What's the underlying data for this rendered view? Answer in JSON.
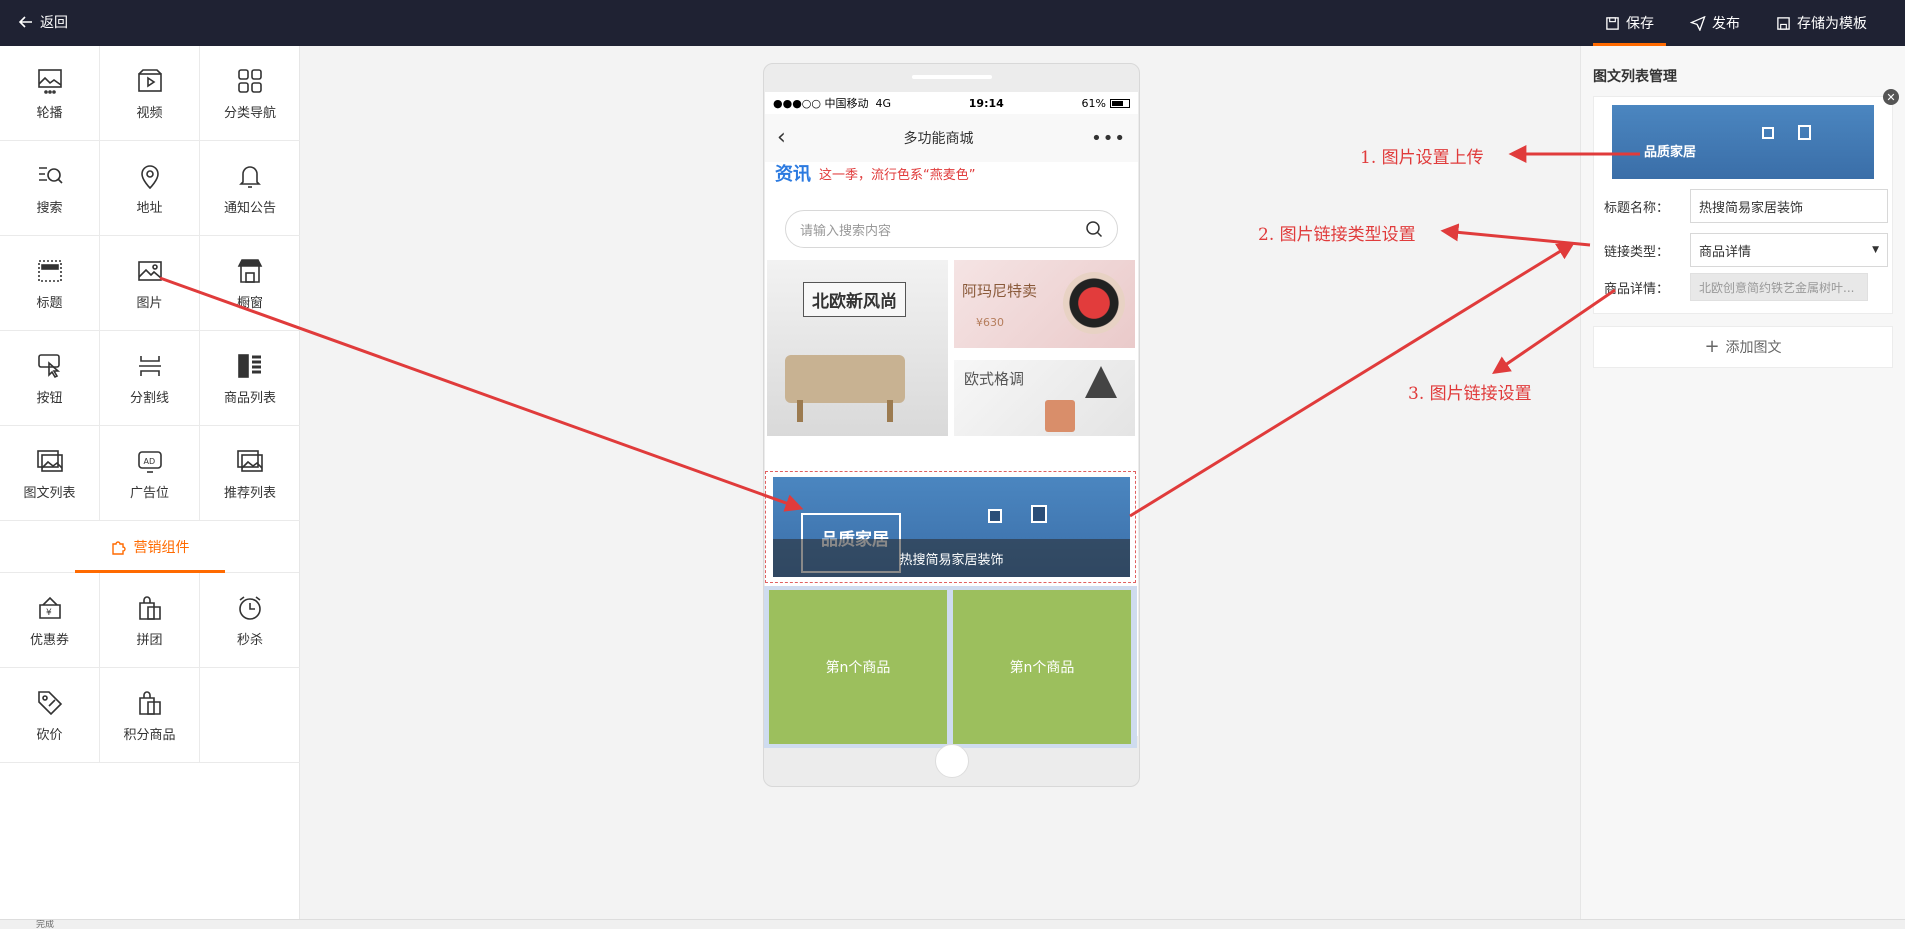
{
  "topbar": {
    "back_label": "返回",
    "save_label": "保存",
    "publish_label": "发布",
    "template_label": "存储为模板"
  },
  "components": [
    {
      "label": "轮播",
      "icon": "image-carousel-icon"
    },
    {
      "label": "视频",
      "icon": "video-icon"
    },
    {
      "label": "分类导航",
      "icon": "grid-icon"
    },
    {
      "label": "搜索",
      "icon": "search-list-icon"
    },
    {
      "label": "地址",
      "icon": "location-icon"
    },
    {
      "label": "通知公告",
      "icon": "bell-icon"
    },
    {
      "label": "标题",
      "icon": "title-icon"
    },
    {
      "label": "图片",
      "icon": "image-icon"
    },
    {
      "label": "橱窗",
      "icon": "shop-window-icon"
    },
    {
      "label": "按钮",
      "icon": "button-click-icon"
    },
    {
      "label": "分割线",
      "icon": "divider-icon"
    },
    {
      "label": "商品列表",
      "icon": "product-list-icon"
    },
    {
      "label": "图文列表",
      "icon": "image-text-list-icon"
    },
    {
      "label": "广告位",
      "icon": "ad-icon"
    },
    {
      "label": "推荐列表",
      "icon": "recommend-list-icon"
    }
  ],
  "marketing_title": "营销组件",
  "marketing": [
    {
      "label": "优惠券",
      "icon": "coupon-icon"
    },
    {
      "label": "拼团",
      "icon": "group-buy-icon"
    },
    {
      "label": "秒杀",
      "icon": "alarm-clock-icon"
    },
    {
      "label": "砍价",
      "icon": "bargain-tag-icon"
    },
    {
      "label": "积分商品",
      "icon": "points-bag-icon"
    }
  ],
  "phone": {
    "carrier": "●●●○○ 中国移动",
    "network": "4G",
    "time": "19:14",
    "battery": "61%",
    "page_title": "多功能商城",
    "news_tag": "资讯",
    "news_text": "这一季，流行色系“燕麦色”",
    "search_placeholder": "请输入搜索内容",
    "banner1_title": "北欧新风尚",
    "banner2_title": "阿玛尼特卖",
    "banner2_price": "¥630",
    "banner3_title": "欧式格调",
    "banner4_text": "品质家居",
    "banner4_caption": "热搜简易家居装饰",
    "goods": [
      "第n个商品",
      "第n个商品"
    ]
  },
  "panel": {
    "title": "图文列表管理",
    "thumb_text": "品质家居",
    "title_label": "标题名称：",
    "title_value": "热搜简易家居装饰",
    "link_type_label": "链接类型：",
    "link_type_value": "商品详情",
    "product_label": "商品详情：",
    "product_value": "北欧创意简约铁艺金属树叶...",
    "add_label": "添加图文"
  },
  "annotations": {
    "a1": "1.  图片设置上传",
    "a2": "2.  图片链接类型设置",
    "a3": "3.  图片链接设置"
  },
  "colors": {
    "accent": "#ff6a00",
    "annotation": "#e03b3b",
    "topbar": "#1f2233",
    "goods": "#9cbf5d"
  },
  "statusbar": "完成"
}
